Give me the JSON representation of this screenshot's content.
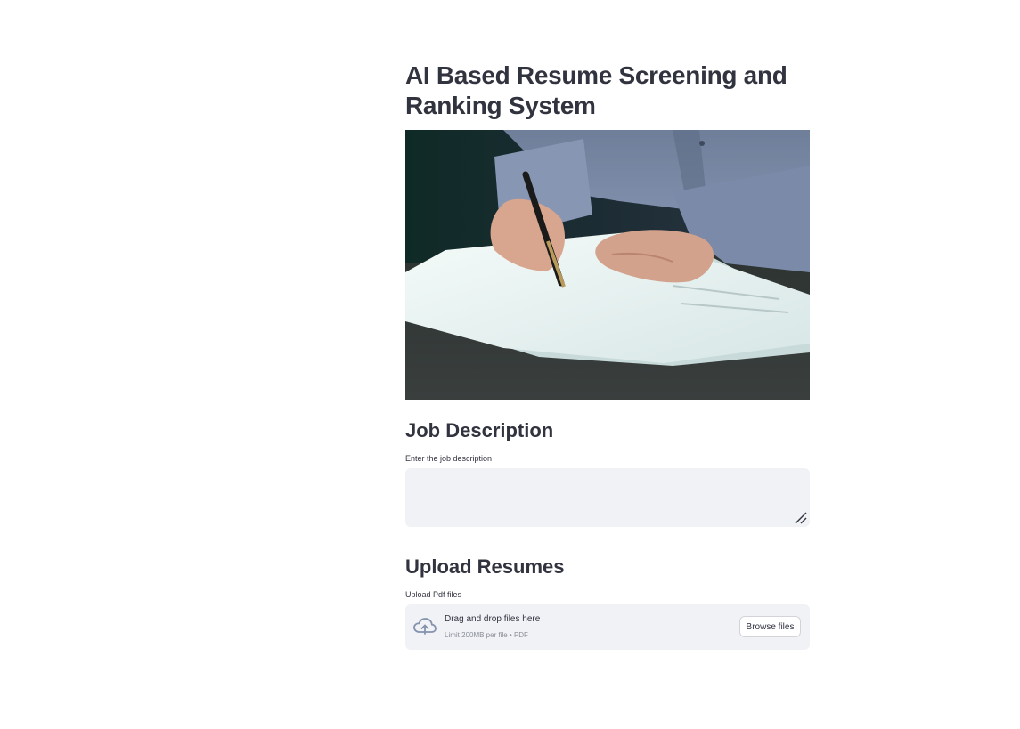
{
  "page": {
    "title": "AI Based Resume Screening and Ranking System"
  },
  "hero_image": {
    "icon": "resume-writing-photo"
  },
  "job_section": {
    "heading": "Job Description",
    "input_label": "Enter the job description",
    "value": ""
  },
  "upload_section": {
    "heading": "Upload Resumes",
    "input_label": "Upload Pdf files",
    "dropzone_title": "Drag and drop files here",
    "dropzone_limit": "Limit 200MB per file • PDF",
    "browse_label": "Browse files",
    "icon": "cloud-upload-icon"
  },
  "colors": {
    "text": "#31333f",
    "input_bg": "#f0f2f6",
    "muted": "#8a8d96"
  }
}
